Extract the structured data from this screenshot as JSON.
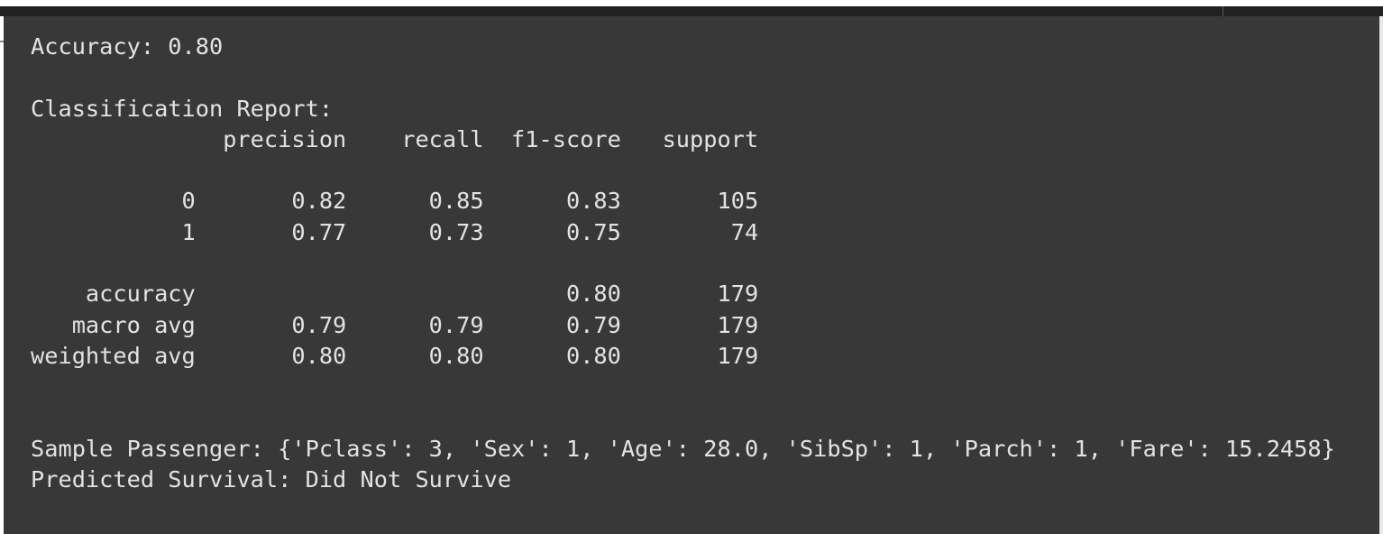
{
  "output": {
    "accuracy_line": "Accuracy: 0.80",
    "blank": "",
    "report_title": "Classification Report:",
    "report_header": "              precision    recall  f1-score   support",
    "report_rows": [
      "           0       0.82      0.85      0.83       105",
      "           1       0.77      0.73      0.75        74"
    ],
    "report_summary": [
      "    accuracy                           0.80       179",
      "   macro avg       0.79      0.79      0.79       179",
      "weighted avg       0.80      0.80      0.80       179"
    ],
    "sample_passenger": "Sample Passenger: {'Pclass': 3, 'Sex': 1, 'Age': 28.0, 'SibSp': 1, 'Parch': 1, 'Fare': 15.2458}",
    "predicted_survival": "Predicted Survival: Did Not Survive"
  },
  "colors": {
    "panel_background": "#383838",
    "text": "#e3e3e3",
    "top_bar": "#212121"
  }
}
